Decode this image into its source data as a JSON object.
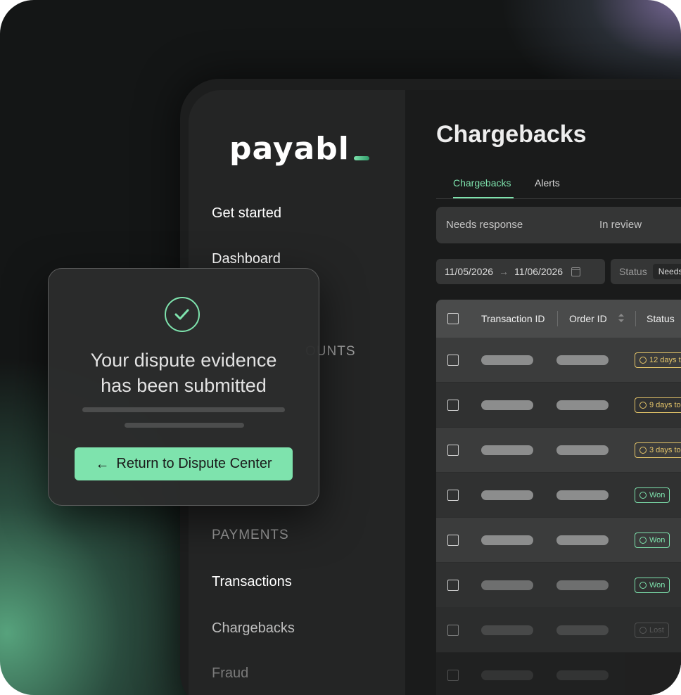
{
  "brand": {
    "logo_text": "payabl",
    "accent": "#7ee3ad"
  },
  "sidebar": {
    "items": [
      {
        "label": "Get started"
      },
      {
        "label": "Dashboard"
      }
    ],
    "section_accounts": "OUNTS",
    "section_payments": "PAYMENTS",
    "payments_items": [
      {
        "label": "Transactions"
      },
      {
        "label": "Chargebacks"
      },
      {
        "label": "Fraud"
      }
    ]
  },
  "main": {
    "title": "Chargebacks",
    "tabs": [
      {
        "label": "Chargebacks",
        "active": true
      },
      {
        "label": "Alerts",
        "active": false
      }
    ],
    "status_filters": [
      "Needs response",
      "In review"
    ],
    "date_range": {
      "from": "11/05/2026",
      "arrow": "→",
      "to": "11/06/2026"
    },
    "status_filter": {
      "label": "Status",
      "value": "Needs"
    }
  },
  "table": {
    "columns": [
      "Transaction ID",
      "Order ID",
      "Status"
    ],
    "rows": [
      {
        "status": "12 days t",
        "kind": "warn"
      },
      {
        "status": "9 days to",
        "kind": "warn"
      },
      {
        "status": "3 days to",
        "kind": "warn"
      },
      {
        "status": "Won",
        "kind": "won"
      },
      {
        "status": "Won",
        "kind": "won"
      },
      {
        "status": "Won",
        "kind": "won"
      },
      {
        "status": "Lost",
        "kind": "lost"
      }
    ]
  },
  "modal": {
    "title_line1": "Your dispute evidence",
    "title_line2": "has been submitted",
    "button_icon": "←",
    "button_label": "Return to Dispute Center"
  }
}
